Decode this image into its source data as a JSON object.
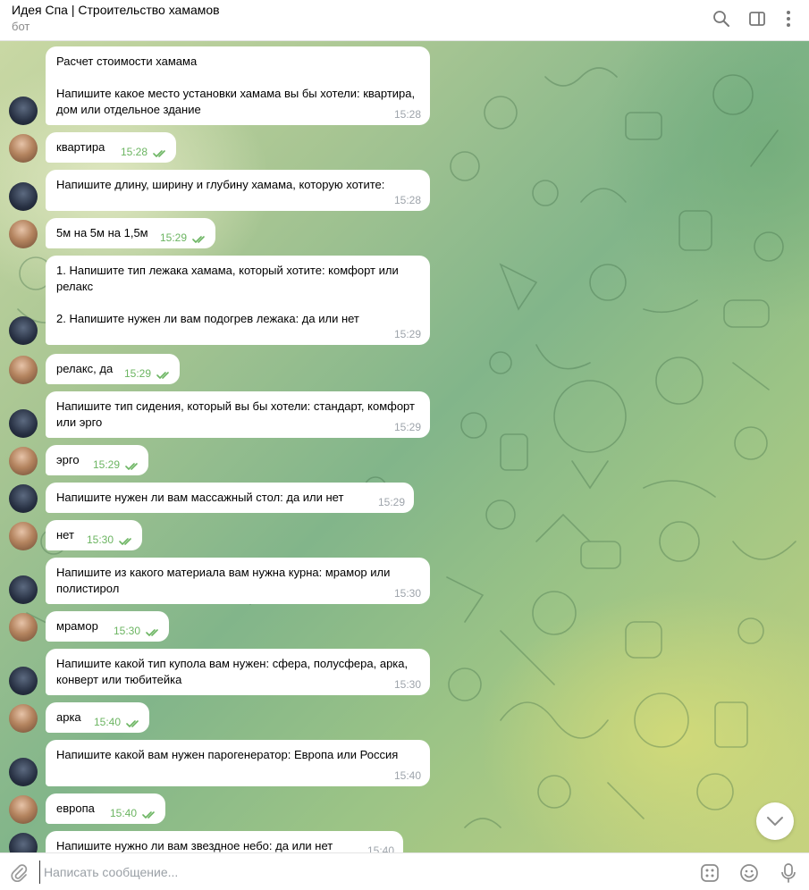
{
  "header": {
    "title": "Идея Спа | Строительство хамамов",
    "subtitle": "бот"
  },
  "messages": [
    {
      "from": "bot",
      "text": "Расчет стоимости хамама\n\nНапишите какое место установки хамама вы бы хотели: квартира, дом или отдельное здание",
      "time": "15:28"
    },
    {
      "from": "user",
      "text": "квартира",
      "time": "15:28",
      "read": true
    },
    {
      "from": "bot",
      "text": "Напишите длину, ширину и глубину хамама, которую хотите:",
      "time": "15:28"
    },
    {
      "from": "user",
      "text": "5м на 5м на 1,5м",
      "time": "15:29",
      "read": true
    },
    {
      "from": "bot",
      "text": "1. Напишите тип лежака хамама, который хотите: комфорт или релакс\n\n2. Напишите нужен ли вам подогрев лежака: да или нет",
      "time": "15:29"
    },
    {
      "from": "user",
      "text": "релакс, да",
      "time": "15:29",
      "read": true
    },
    {
      "from": "bot",
      "text": "Напишите тип сидения, который вы бы хотели: стандарт, комфорт или эрго",
      "time": "15:29"
    },
    {
      "from": "user",
      "text": "эрго",
      "time": "15:29",
      "read": true
    },
    {
      "from": "bot",
      "text": "Напишите нужен ли вам массажный стол: да или нет",
      "time": "15:29"
    },
    {
      "from": "user",
      "text": "нет",
      "time": "15:30",
      "read": true
    },
    {
      "from": "bot",
      "text": "Напишите из какого материала вам нужна курна: мрамор или полистирол",
      "time": "15:30"
    },
    {
      "from": "user",
      "text": "мрамор",
      "time": "15:30",
      "read": true
    },
    {
      "from": "bot",
      "text": "Напишите какой тип купола вам нужен: сфера, полусфера, арка, конверт или тюбитейка",
      "time": "15:30"
    },
    {
      "from": "user",
      "text": "арка",
      "time": "15:40",
      "read": true
    },
    {
      "from": "bot",
      "text": "Напишите какой вам нужен парогенератор: Европа или Россия",
      "time": "15:40"
    },
    {
      "from": "user",
      "text": "европа",
      "time": "15:40",
      "read": true
    },
    {
      "from": "bot",
      "text": "Напишите нужно ли вам звездное небо: да или нет",
      "time": "15:40"
    }
  ],
  "composer": {
    "placeholder": "Написать сообщение..."
  },
  "icons": {
    "search": "search-icon",
    "sidebar": "sidebar-toggle-icon",
    "more": "more-vertical-icon",
    "attach": "paperclip-icon",
    "commands": "bot-commands-icon",
    "emoji": "emoji-icon",
    "mic": "microphone-icon",
    "scroll": "chevron-down-icon"
  },
  "colors": {
    "outgoing_time": "#6cb562",
    "incoming_time": "#9ea4ab",
    "bubble": "#ffffff"
  }
}
